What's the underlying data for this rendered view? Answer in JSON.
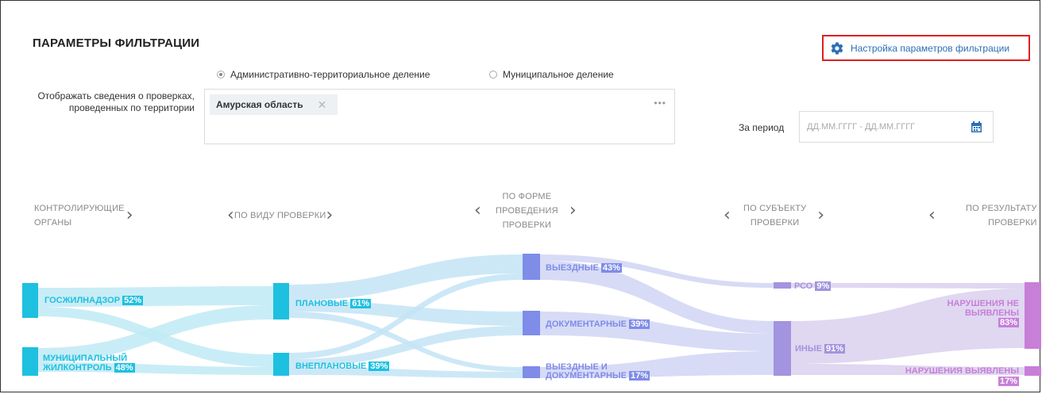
{
  "filters": {
    "title": "ПАРАМЕТРЫ ФИЛЬТРАЦИИ",
    "settings_link": "Настройка параметров фильтрации",
    "radio_admin": "Административно-территориальное деление",
    "radio_municipal": "Муниципальное деление",
    "territory_label": "Отображать сведения о проверках, проведенных по территории",
    "territory_tag": "Амурская область",
    "territory_more": "•••",
    "period_label": "За период",
    "period_placeholder": "ДД.ММ.ГГГГ - ДД.ММ.ГГГГ"
  },
  "columns": {
    "c1": [
      "КОНТРОЛИРУЮЩИЕ",
      "ОРГАНЫ"
    ],
    "c2": "ПО ВИДУ ПРОВЕРКИ",
    "c3": [
      "ПО ФОРМЕ",
      "ПРОВЕДЕНИЯ",
      "ПРОВЕРКИ"
    ],
    "c4": [
      "ПО СУБЪЕКТУ",
      "ПРОВЕРКИ"
    ],
    "c5": [
      "ПО РЕЗУЛЬТАТУ",
      "ПРОВЕРКИ"
    ]
  },
  "nodes": {
    "goszhil": {
      "label": "ГОСЖИЛНАДЗОР",
      "pct": "52%"
    },
    "munzhil": {
      "label1": "МУНИЦИПАЛЬНЫЙ",
      "label2": "ЖИЛКОНТРОЛЬ",
      "pct": "48%"
    },
    "planned": {
      "label": "ПЛАНОВЫЕ",
      "pct": "61%"
    },
    "unplanned": {
      "label": "ВНЕПЛАНОВЫЕ",
      "pct": "39%"
    },
    "onsite": {
      "label": "ВЫЕЗДНЫЕ",
      "pct": "43%"
    },
    "docs": {
      "label": "ДОКУМЕНТАРНЫЕ",
      "pct": "39%"
    },
    "onsite_docs": {
      "label1": "ВЫЕЗДНЫЕ И",
      "label2": "ДОКУМЕНТАРНЫЕ",
      "pct": "17%"
    },
    "rso": {
      "label": "РСО",
      "pct": "9%"
    },
    "other": {
      "label": "ИНЫЕ",
      "pct": "91%"
    },
    "no_violations": {
      "label1": "НАРУШЕНИЯ НЕ",
      "label2": "ВЫЯВЛЕНЫ",
      "pct": "83%"
    },
    "violations": {
      "label": "НАРУШЕНИЯ ВЫЯВЛЕНЫ",
      "pct": "17%"
    }
  },
  "colors": {
    "cyan": "#1ec0e0",
    "cyan_flow": "#bfeaf4",
    "blue": "#8a95ea",
    "blue_flow": "#d3d7f5",
    "purple": "#a48fd9",
    "purple_flow": "#ddd3f0",
    "magenta": "#c77fd8",
    "red_border": "#e01f1f",
    "link": "#2a6fb4"
  }
}
